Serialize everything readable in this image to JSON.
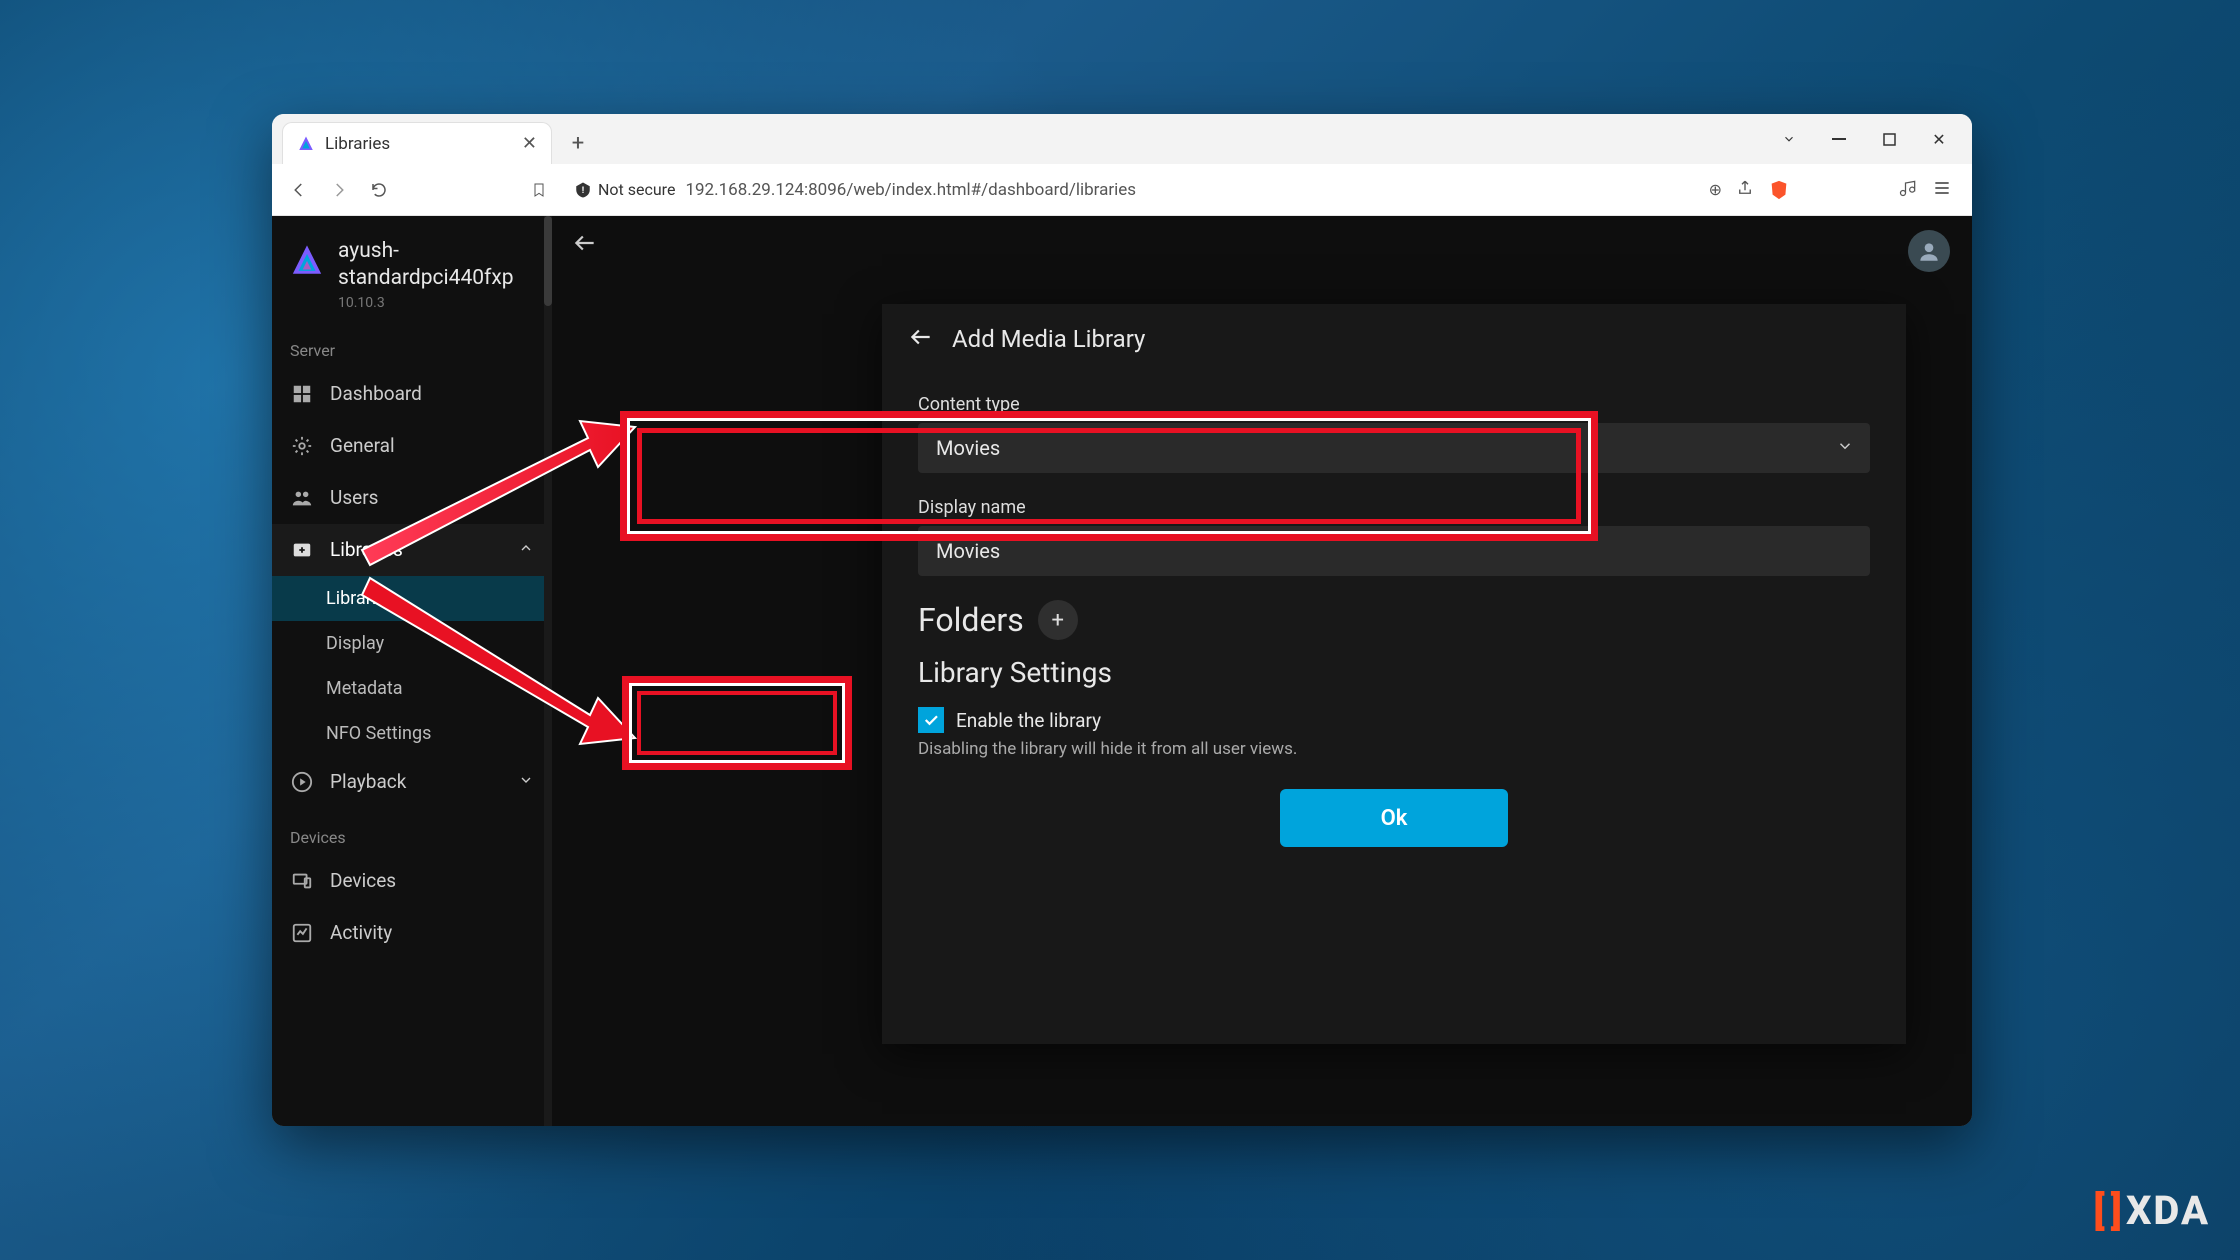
{
  "browser": {
    "tab_title": "Libraries",
    "security_label": "Not secure",
    "url": "192.168.29.124:8096/web/index.html#/dashboard/libraries"
  },
  "sidebar": {
    "server_name_line1": "ayush-",
    "server_name_line2": "standardpci440fxp",
    "version": "10.10.3",
    "section_server": "Server",
    "section_devices": "Devices",
    "items": {
      "dashboard": "Dashboard",
      "general": "General",
      "users": "Users",
      "libraries": "Libraries",
      "playback": "Playback",
      "devices": "Devices",
      "activity": "Activity"
    },
    "sub": {
      "libraries": "Libraries",
      "display": "Display",
      "metadata": "Metadata",
      "nfo": "NFO Settings"
    }
  },
  "dialog": {
    "title": "Add Media Library",
    "content_type_label": "Content type",
    "content_type_value": "Movies",
    "display_name_label": "Display name",
    "display_name_value": "Movies",
    "folders_title": "Folders",
    "library_settings_title": "Library Settings",
    "enable_label": "Enable the library",
    "enable_help": "Disabling the library will hide it from all user views.",
    "ok_label": "Ok"
  },
  "watermark": {
    "text": "XDA"
  }
}
